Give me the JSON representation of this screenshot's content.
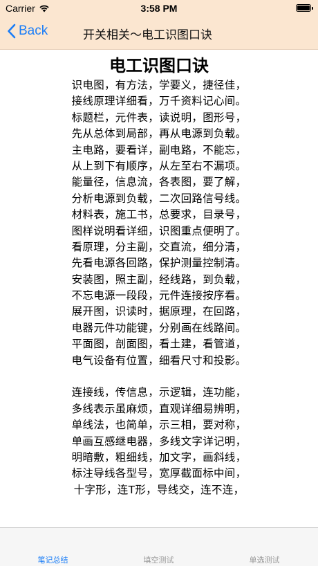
{
  "status_bar": {
    "carrier": "Carrier",
    "time": "3:58 PM",
    "wifi_icon": "wifi-icon",
    "battery_icon": "battery-full-icon"
  },
  "nav": {
    "back_label": "Back",
    "back_icon": "chevron-left-icon",
    "title": "开关相关～电工识图口诀",
    "accent_color": "#1a7df7",
    "background_color": "#fbe6d0"
  },
  "document": {
    "title": "电工识图口诀",
    "section1": [
      " 识电图，有方法，学要义，捷径佳，",
      "接线原理详细看，万千资料记心间。",
      "标题栏，元件表，读说明，图形号，",
      "先从总体到局部，再从电源到负载。",
      "主电路，要看详，副电路，不能忘，",
      "从上到下有顺序，从左至右不漏项。",
      "能量径，信息流，各表图，要了解，",
      "分析电源到负载，二次回路信号线。",
      "材料表，施工书，总要求，目录号，",
      "图样说明看详细，识图重点便明了。",
      "看原理，分主副，交直流，细分清，",
      "先看电源各回路，保护测量控制清。",
      "安装图，照主副，经线路，到负载，",
      "不忘电源一段段，元件连接按序看。",
      "展开图，识读时，据原理，在回路，",
      "电器元件功能键，分别画在线路间。",
      "平面图，剖面图，看土建，看管道，",
      "电气设备有位置，细看尺寸和投影。"
    ],
    "section2": [
      "连接线，传信息，示逻辑，连功能，",
      "多线表示虽麻烦，直观详细易辨明，",
      "单线法，也简单，示三相，要对称，",
      "单画互感继电器，多线文字详记明，",
      "明暗敷，粗细线，加文字，画斜线，",
      "标注导线各型号，宽厚截面标中间，",
      "十字形，连T形，导线交，连不连，"
    ]
  },
  "tab_bar": {
    "tabs": [
      {
        "label": "笔记总结",
        "active": true
      },
      {
        "label": "填空测试",
        "active": false
      },
      {
        "label": "单选测试",
        "active": false
      }
    ],
    "active_color": "#1a7df7",
    "inactive_color": "#999999"
  }
}
